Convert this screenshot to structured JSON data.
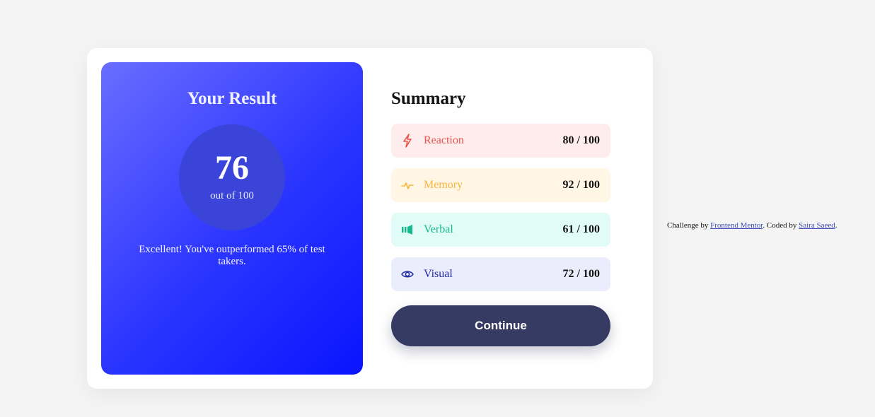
{
  "result": {
    "title": "Your Result",
    "score": "76",
    "out_of": "out of 100",
    "message": "Excellent! You've outperformed 65% of test takers."
  },
  "summary": {
    "title": "Summary",
    "items": [
      {
        "label": "Reaction",
        "score": "80 / 100",
        "icon": "lightning-icon",
        "color": "#e8544d",
        "bg": "#ffecec"
      },
      {
        "label": "Memory",
        "score": "92 / 100",
        "icon": "pulse-icon",
        "color": "#f6b53a",
        "bg": "#fff6e5"
      },
      {
        "label": "Verbal",
        "score": "61 / 100",
        "icon": "speaker-icon",
        "color": "#17b98c",
        "bg": "#e1fcf6"
      },
      {
        "label": "Visual",
        "score": "72 / 100",
        "icon": "eye-icon",
        "color": "#1e2aa8",
        "bg": "#ebedfc"
      }
    ]
  },
  "continue_label": "Continue",
  "attribution": {
    "prefix": "Challenge by ",
    "link1": "Frontend Mentor",
    "middle": ". Coded by ",
    "link2": "Saira Saeed",
    "suffix": "."
  }
}
